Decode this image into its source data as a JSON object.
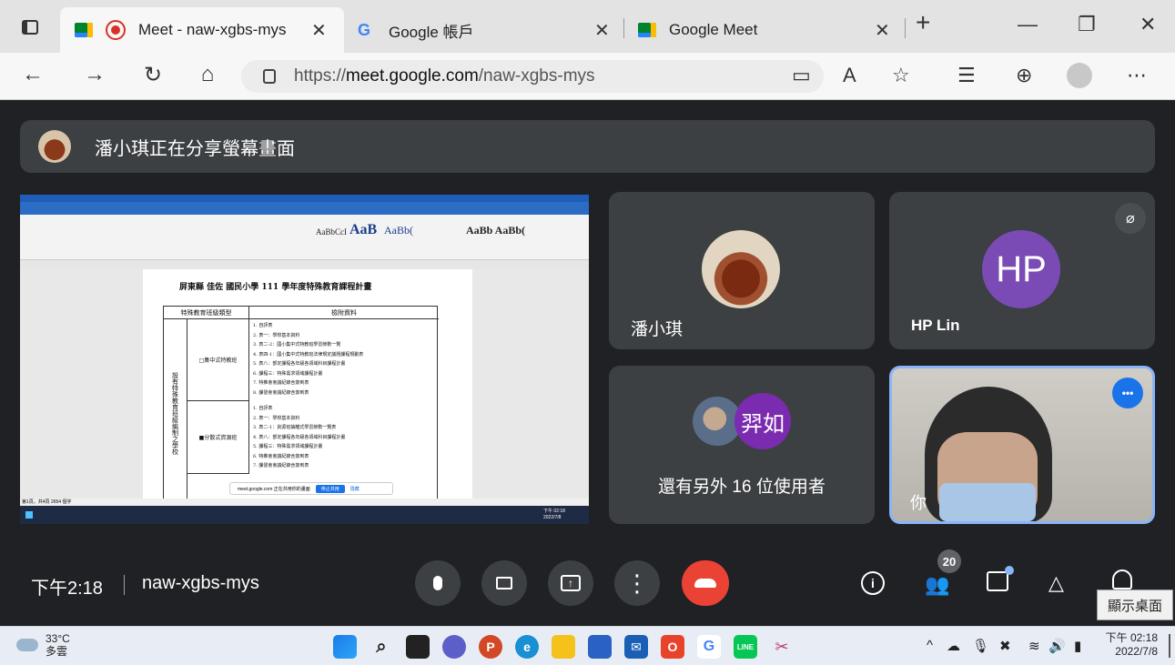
{
  "browser": {
    "tabs": [
      {
        "title": "Meet - naw-xgbs-mys",
        "active": true
      },
      {
        "title": "Google 帳戶",
        "active": false
      },
      {
        "title": "Google Meet",
        "active": false
      }
    ],
    "url_prefix": "https://",
    "url_host": "meet.google.com",
    "url_path": "/naw-xgbs-mys",
    "icons": {
      "tab_actions": "tab-actions-icon",
      "new_tab": "+",
      "minimize": "—",
      "restore": "❐",
      "close": "✕",
      "close_tab": "✕"
    }
  },
  "nav": {
    "back": "←",
    "forward": "→",
    "refresh": "↻",
    "home": "⌂",
    "camera": "▭",
    "read_aloud": "A",
    "favorite": "☆",
    "favorites": "☰",
    "collections": "⊕",
    "more": "⋯",
    "lock": "🔒"
  },
  "meet": {
    "presenting_banner": "潘小琪正在分享螢幕畫面",
    "shared_doc": {
      "title_line": "屏東縣  佳佐  國民小學 111 學年度特殊教育課程計畫",
      "col1": "特殊教育班級類型",
      "col2": "檢附資料",
      "row_header": "設有特殊教育班級編制之學校",
      "row1_label": "□集中式特教班",
      "row2_label": "■分散式資源班",
      "row1_items": [
        "1. 自評表",
        "2. 表一：學校基本資料",
        "3. 表二-2：國小集中式特教班學習節數一覽",
        "4. 表四-1：國小集中式特教班法律規定議題課程規劃表",
        "5. 表八：部定課程各年級各領域科目課程計畫",
        "6. 課程三：特殊需求領域課程計畫",
        "7. 特推會會議紀錄含簽到表",
        "8. 課發會會議紀錄含簽到表"
      ],
      "row2_items": [
        "1. 自評表",
        "2. 表一：學校基本資料",
        "3. 表二-1：資源班抽離式學習節數一覽表",
        "4. 表八：部定課程各年級各領域科目課程計畫",
        "5. 課程三：特殊需求領域課程計畫",
        "6. 特推會會議紀錄含簽到表",
        "7. 課發會會議紀錄含簽到表"
      ],
      "share_bar_text": "meet.google.com 正在共用你的畫面",
      "share_bar_stop": "停止共用",
      "share_bar_hide": "隱藏",
      "status": "第1頁，共4頁  2654 個字",
      "clock_time": "下午 02:18",
      "clock_date": "2022/7/8"
    },
    "tiles": [
      {
        "name": "潘小琪"
      },
      {
        "name": "HP Lin",
        "initials": "HP",
        "avatar_color": "#7b4bb5",
        "muted": true
      },
      {
        "name": "還有另外 16 位使用者",
        "avatar_initial": "羿如",
        "avatar_color": "#7b2bb0"
      },
      {
        "name": "你",
        "more_button": "•••",
        "more_color": "#1a73e8"
      }
    ],
    "time": "下午2:18",
    "meeting_code": "naw-xgbs-mys",
    "participant_count": "20",
    "tooltip": "顯示桌面",
    "end_call_color": "#ea4335"
  },
  "taskbar": {
    "weather_temp": "33°C",
    "weather_desc": "多雲",
    "clock_time": "下午 02:18",
    "clock_date": "2022/7/8"
  }
}
